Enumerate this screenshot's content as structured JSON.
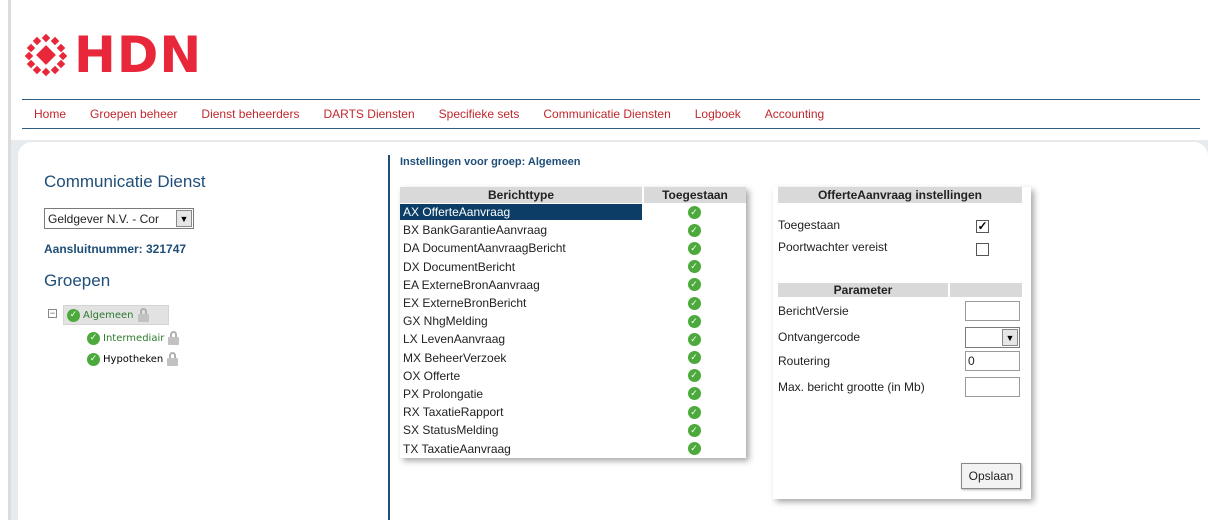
{
  "brand": {
    "name": "HDN",
    "color": "#e8283a"
  },
  "nav": {
    "items": [
      {
        "label": "Home"
      },
      {
        "label": "Groepen beheer"
      },
      {
        "label": "Dienst beheerders"
      },
      {
        "label": "DARTS Diensten"
      },
      {
        "label": "Specifieke sets"
      },
      {
        "label": "Communicatie Diensten"
      },
      {
        "label": "Logboek"
      },
      {
        "label": "Accounting"
      }
    ]
  },
  "sidebar": {
    "title": "Communicatie Dienst",
    "dienst_select": {
      "value": "Geldgever N.V. - Cor"
    },
    "aansluitnummer": "Aansluitnummer: 321747",
    "groepen_title": "Groepen",
    "tree": [
      {
        "label": "Algemeen",
        "selected": true
      },
      {
        "label": "Intermediair",
        "selected": false
      },
      {
        "label": "Hypotheken",
        "selected": false
      }
    ]
  },
  "main": {
    "title": "Instellingen voor groep: Algemeen",
    "table": {
      "headers": [
        "Berichttype",
        "Toegestaan"
      ],
      "rows": [
        {
          "type": "AX OfferteAanvraag",
          "allowed": true,
          "active": true
        },
        {
          "type": "BX BankGarantieAanvraag",
          "allowed": true
        },
        {
          "type": "DA DocumentAanvraagBericht",
          "allowed": true
        },
        {
          "type": "DX DocumentBericht",
          "allowed": true
        },
        {
          "type": "EA ExterneBronAanvraag",
          "allowed": true
        },
        {
          "type": "EX ExterneBronBericht",
          "allowed": true
        },
        {
          "type": "GX NhgMelding",
          "allowed": true
        },
        {
          "type": "LX LevenAanvraag",
          "allowed": true
        },
        {
          "type": "MX BeheerVerzoek",
          "allowed": true
        },
        {
          "type": "OX Offerte",
          "allowed": true
        },
        {
          "type": "PX Prolongatie",
          "allowed": true
        },
        {
          "type": "RX TaxatieRapport",
          "allowed": true
        },
        {
          "type": "SX StatusMelding",
          "allowed": true
        },
        {
          "type": "TX TaxatieAanvraag",
          "allowed": true
        }
      ]
    }
  },
  "settings": {
    "title": "OfferteAanvraag instellingen",
    "toegestaan_label": "Toegestaan",
    "toegestaan_checked": true,
    "poortwachter_label": "Poortwachter vereist",
    "poortwachter_checked": false,
    "parameter_header": "Parameter",
    "params": {
      "berichtversie_label": "BerichtVersie",
      "berichtversie_value": "",
      "ontvangercode_label": "Ontvangercode",
      "ontvangercode_value": "",
      "routering_label": "Routering",
      "routering_value": "0",
      "max_label": "Max. bericht grootte (in Mb)",
      "max_value": ""
    },
    "save_label": "Opslaan"
  }
}
